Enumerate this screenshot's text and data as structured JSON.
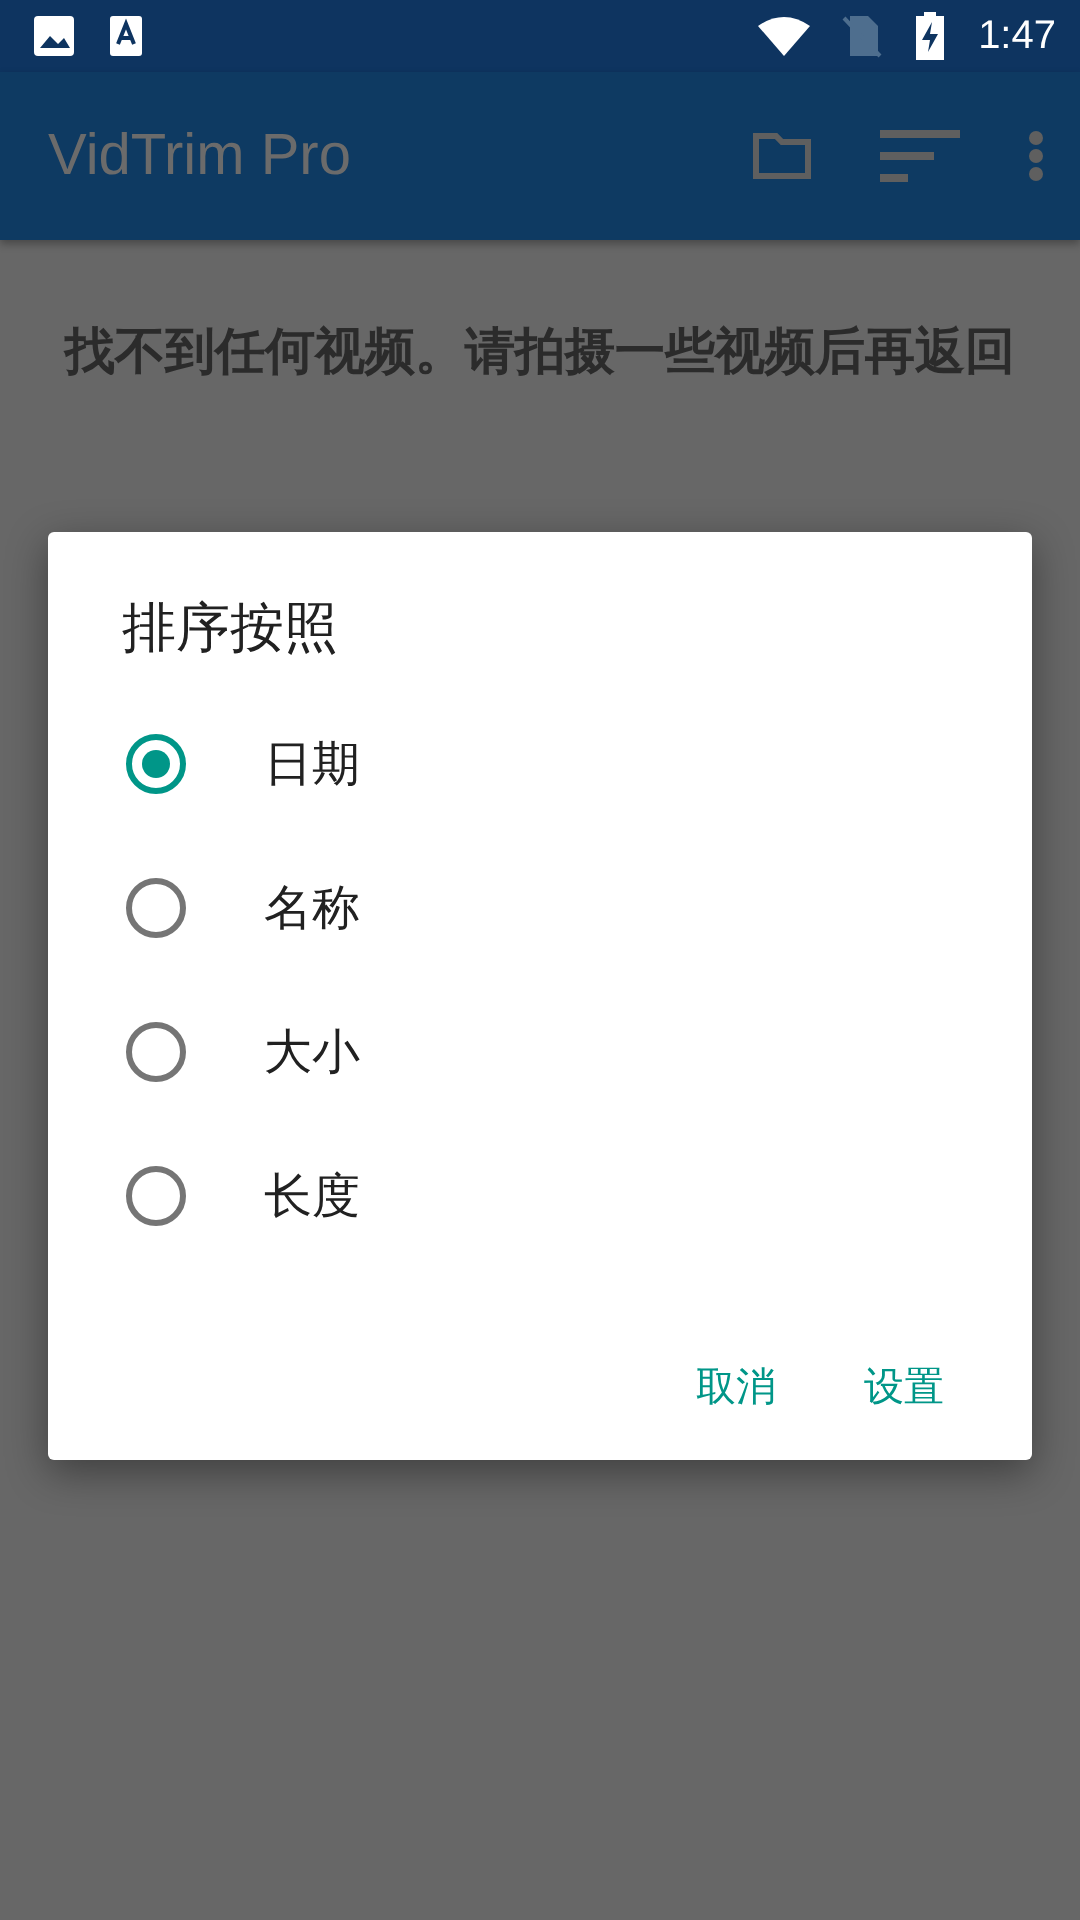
{
  "status_bar": {
    "time": "1:47"
  },
  "app_bar": {
    "title": "VidTrim Pro"
  },
  "message": "找不到任何视频。请拍摄一些视频后再返回",
  "dialog": {
    "title": "排序按照",
    "options": [
      {
        "label": "日期",
        "selected": true
      },
      {
        "label": "名称",
        "selected": false
      },
      {
        "label": "大小",
        "selected": false
      },
      {
        "label": "长度",
        "selected": false
      }
    ],
    "buttons": [
      "取消",
      "设置"
    ]
  }
}
